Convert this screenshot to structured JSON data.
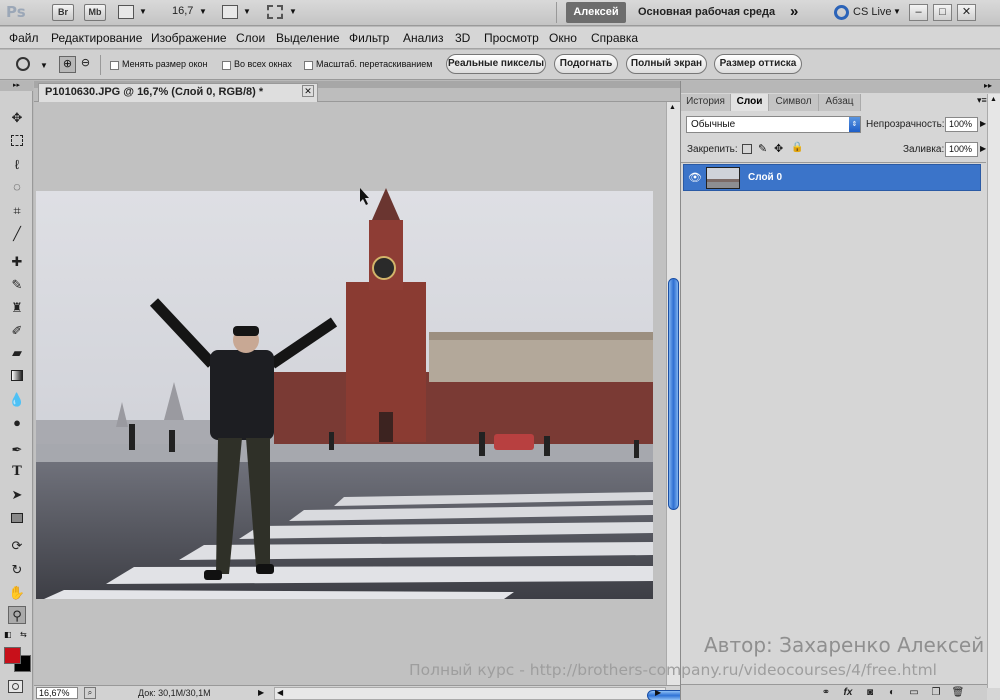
{
  "app": {
    "logo": "Ps",
    "buttons": [
      "Br",
      "Mb"
    ],
    "zoom_select": "16,7",
    "user_name": "Алексей",
    "workspace": "Основная рабочая среда",
    "workspace_more": "»",
    "cs_live": "CS Live",
    "window_controls": [
      "–",
      "□",
      "✕"
    ]
  },
  "menu": [
    "Файл",
    "Редактирование",
    "Изображение",
    "Слои",
    "Выделение",
    "Фильтр",
    "Анализ",
    "3D",
    "Просмотр",
    "Окно",
    "Справка"
  ],
  "options": {
    "checkboxes": [
      "Менять размер окон",
      "Во всех окнах",
      "Масштаб. перетаскиванием"
    ],
    "buttons": [
      "Реальные пикселы",
      "Подогнать",
      "Полный экран",
      "Размер оттиска"
    ]
  },
  "tools": [
    "move-icon",
    "marquee-icon",
    "lasso-icon",
    "quick-select-icon",
    "crop-icon",
    "eyedropper-icon",
    "healing-icon",
    "brush-icon",
    "clone-stamp-icon",
    "history-brush-icon",
    "eraser-icon",
    "gradient-icon",
    "blur-icon",
    "dodge-icon",
    "pen-icon",
    "type-icon",
    "path-select-icon",
    "shape-icon",
    "3d-rotate-icon",
    "3d-orbit-icon",
    "hand-icon",
    "zoom-icon"
  ],
  "colors": {
    "foreground": "#c8101a",
    "background": "#000000",
    "selection": "#3b74c9"
  },
  "document": {
    "tab_title": "P1010630.JPG @ 16,7% (Слой 0, RGB/8) *",
    "status_zoom": "16,67%",
    "status_doc": "Док: 30,1M/30,1M"
  },
  "panel": {
    "tabs": [
      "История",
      "Слои",
      "Символ",
      "Абзац"
    ],
    "active_tab": "Слои",
    "blend_mode": "Обычные",
    "opacity_label": "Непрозрачность:",
    "opacity_value": "100%",
    "lock_label": "Закрепить:",
    "fill_label": "Заливка:",
    "fill_value": "100%",
    "layers": [
      {
        "name": "Слой 0",
        "visible": true,
        "selected": true
      }
    ]
  },
  "watermark": {
    "author": "Автор: Захаренко Алексей",
    "course": "Полный курс - http://brothers-company.ru/videocourses/4/free.html"
  }
}
